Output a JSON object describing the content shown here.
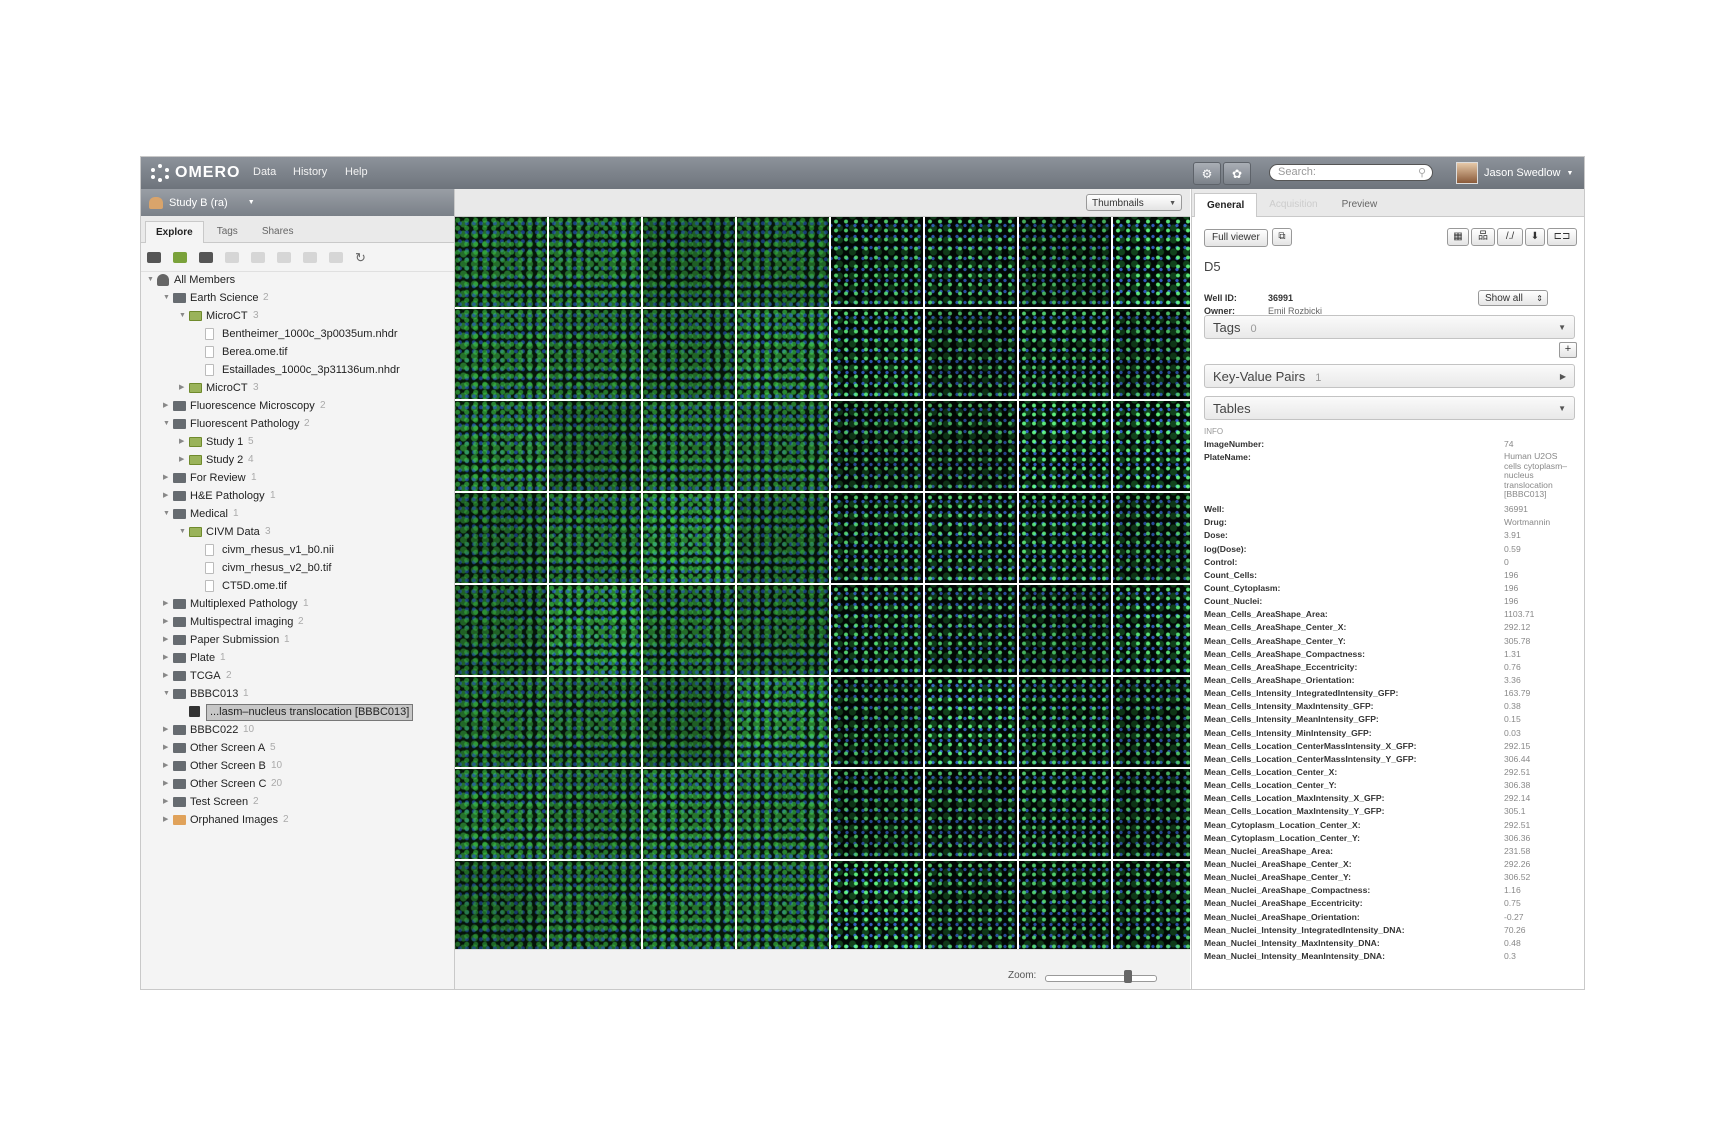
{
  "topbar": {
    "logo": "OMERO",
    "menu": [
      "Data",
      "History",
      "Help"
    ],
    "search_placeholder": "Search:",
    "user": "Jason Swedlow"
  },
  "left": {
    "group": "Study B (ra)",
    "tabs": [
      "Explore",
      "Tags",
      "Shares"
    ],
    "tree": [
      {
        "label": "All Members",
        "count": "",
        "depth": 0,
        "icon": "users-icon",
        "arrow": "down"
      },
      {
        "label": "Earth Science",
        "count": "2",
        "depth": 1,
        "icon": "folder-icon",
        "arrow": "down"
      },
      {
        "label": "MicroCT",
        "count": "3",
        "depth": 2,
        "icon": "project-folder-icon",
        "arrow": "down"
      },
      {
        "label": "Bentheimer_1000c_3p0035um.nhdr",
        "count": "",
        "depth": 3,
        "icon": "file-icon",
        "arrow": ""
      },
      {
        "label": "Berea.ome.tif",
        "count": "",
        "depth": 3,
        "icon": "file-icon",
        "arrow": ""
      },
      {
        "label": "Estaillades_1000c_3p31136um.nhdr",
        "count": "",
        "depth": 3,
        "icon": "file-icon",
        "arrow": ""
      },
      {
        "label": "MicroCT",
        "count": "3",
        "depth": 2,
        "icon": "project-folder-icon",
        "arrow": "right"
      },
      {
        "label": "Fluorescence Microscopy",
        "count": "2",
        "depth": 1,
        "icon": "folder-icon",
        "arrow": "right"
      },
      {
        "label": "Fluorescent Pathology",
        "count": "2",
        "depth": 1,
        "icon": "folder-icon",
        "arrow": "down"
      },
      {
        "label": "Study 1",
        "count": "5",
        "depth": 2,
        "icon": "project-folder-icon",
        "arrow": "right"
      },
      {
        "label": "Study 2",
        "count": "4",
        "depth": 2,
        "icon": "project-folder-icon",
        "arrow": "right"
      },
      {
        "label": "For Review",
        "count": "1",
        "depth": 1,
        "icon": "folder-icon",
        "arrow": "right"
      },
      {
        "label": "H&E Pathology",
        "count": "1",
        "depth": 1,
        "icon": "folder-icon",
        "arrow": "right"
      },
      {
        "label": "Medical",
        "count": "1",
        "depth": 1,
        "icon": "folder-icon",
        "arrow": "down"
      },
      {
        "label": "CIVM Data",
        "count": "3",
        "depth": 2,
        "icon": "project-folder-icon",
        "arrow": "down"
      },
      {
        "label": "civm_rhesus_v1_b0.nii",
        "count": "",
        "depth": 3,
        "icon": "file-icon",
        "arrow": ""
      },
      {
        "label": "civm_rhesus_v2_b0.tif",
        "count": "",
        "depth": 3,
        "icon": "file-icon",
        "arrow": ""
      },
      {
        "label": "CT5D.ome.tif",
        "count": "",
        "depth": 3,
        "icon": "file-icon",
        "arrow": ""
      },
      {
        "label": "Multiplexed Pathology",
        "count": "1",
        "depth": 1,
        "icon": "folder-icon",
        "arrow": "right"
      },
      {
        "label": "Multispectral imaging",
        "count": "2",
        "depth": 1,
        "icon": "folder-icon",
        "arrow": "right"
      },
      {
        "label": "Paper Submission",
        "count": "1",
        "depth": 1,
        "icon": "folder-icon",
        "arrow": "right"
      },
      {
        "label": "Plate",
        "count": "1",
        "depth": 1,
        "icon": "folder-icon",
        "arrow": "right"
      },
      {
        "label": "TCGA",
        "count": "2",
        "depth": 1,
        "icon": "folder-icon",
        "arrow": "right"
      },
      {
        "label": "BBBC013",
        "count": "1",
        "depth": 1,
        "icon": "folder-icon",
        "arrow": "down"
      },
      {
        "label": "...lasm–nucleus translocation [BBBC013]",
        "count": "",
        "depth": 2,
        "icon": "plate-icon",
        "arrow": "",
        "selected": true
      },
      {
        "label": "BBBC022",
        "count": "10",
        "depth": 1,
        "icon": "folder-icon",
        "arrow": "right"
      },
      {
        "label": "Other Screen A",
        "count": "5",
        "depth": 1,
        "icon": "folder-icon",
        "arrow": "right"
      },
      {
        "label": "Other Screen B",
        "count": "10",
        "depth": 1,
        "icon": "folder-icon",
        "arrow": "right"
      },
      {
        "label": "Other Screen C",
        "count": "20",
        "depth": 1,
        "icon": "folder-icon",
        "arrow": "right"
      },
      {
        "label": "Test Screen",
        "count": "2",
        "depth": 1,
        "icon": "folder-icon",
        "arrow": "right"
      },
      {
        "label": "Orphaned Images",
        "count": "2",
        "depth": 1,
        "icon": "orphaned-folder-icon",
        "arrow": "right"
      }
    ]
  },
  "center": {
    "view_select": "Thumbnails",
    "zoom_label": "Zoom:",
    "zoom_level": 0.75,
    "grid": {
      "rows": 8,
      "cols": 8
    }
  },
  "right": {
    "tabs": [
      "General",
      "Acquisition",
      "Preview"
    ],
    "full_viewer": "Full viewer",
    "well_name": "D5",
    "well_id_label": "Well ID:",
    "well_id": "36991",
    "owner_label": "Owner:",
    "owner": "Emil Rozbicki",
    "show_all": "Show all",
    "tags_label": "Tags",
    "tags_count": "0",
    "kvp_label": "Key-Value Pairs",
    "kvp_count": "1",
    "tables_label": "Tables",
    "info_label": "INFO",
    "info": [
      {
        "k": "ImageNumber:",
        "v": "74"
      },
      {
        "k": "PlateName:",
        "v": "Human U2OS cells cytoplasm–nucleus translocation [BBBC013]",
        "multiline": true
      },
      {
        "k": "Well:",
        "v": "36991"
      },
      {
        "k": "Drug:",
        "v": "Wortmannin"
      },
      {
        "k": "Dose:",
        "v": "3.91"
      },
      {
        "k": "log(Dose):",
        "v": "0.59"
      },
      {
        "k": "Control:",
        "v": "0"
      },
      {
        "k": "Count_Cells:",
        "v": "196"
      },
      {
        "k": "Count_Cytoplasm:",
        "v": "196"
      },
      {
        "k": "Count_Nuclei:",
        "v": "196"
      },
      {
        "k": "Mean_Cells_AreaShape_Area:",
        "v": "1103.71"
      },
      {
        "k": "Mean_Cells_AreaShape_Center_X:",
        "v": "292.12"
      },
      {
        "k": "Mean_Cells_AreaShape_Center_Y:",
        "v": "305.78"
      },
      {
        "k": "Mean_Cells_AreaShape_Compactness:",
        "v": "1.31"
      },
      {
        "k": "Mean_Cells_AreaShape_Eccentricity:",
        "v": "0.76"
      },
      {
        "k": "Mean_Cells_AreaShape_Orientation:",
        "v": "3.36"
      },
      {
        "k": "Mean_Cells_Intensity_IntegratedIntensity_GFP:",
        "v": "163.79"
      },
      {
        "k": "Mean_Cells_Intensity_MaxIntensity_GFP:",
        "v": "0.38"
      },
      {
        "k": "Mean_Cells_Intensity_MeanIntensity_GFP:",
        "v": "0.15"
      },
      {
        "k": "Mean_Cells_Intensity_MinIntensity_GFP:",
        "v": "0.03"
      },
      {
        "k": "Mean_Cells_Location_CenterMassIntensity_X_GFP:",
        "v": "292.15"
      },
      {
        "k": "Mean_Cells_Location_CenterMassIntensity_Y_GFP:",
        "v": "306.44"
      },
      {
        "k": "Mean_Cells_Location_Center_X:",
        "v": "292.51"
      },
      {
        "k": "Mean_Cells_Location_Center_Y:",
        "v": "306.38"
      },
      {
        "k": "Mean_Cells_Location_MaxIntensity_X_GFP:",
        "v": "292.14"
      },
      {
        "k": "Mean_Cells_Location_MaxIntensity_Y_GFP:",
        "v": "305.1"
      },
      {
        "k": "Mean_Cytoplasm_Location_Center_X:",
        "v": "292.51"
      },
      {
        "k": "Mean_Cytoplasm_Location_Center_Y:",
        "v": "306.36"
      },
      {
        "k": "Mean_Nuclei_AreaShape_Area:",
        "v": "231.58"
      },
      {
        "k": "Mean_Nuclei_AreaShape_Center_X:",
        "v": "292.26"
      },
      {
        "k": "Mean_Nuclei_AreaShape_Center_Y:",
        "v": "306.52"
      },
      {
        "k": "Mean_Nuclei_AreaShape_Compactness:",
        "v": "1.16"
      },
      {
        "k": "Mean_Nuclei_AreaShape_Eccentricity:",
        "v": "0.75"
      },
      {
        "k": "Mean_Nuclei_AreaShape_Orientation:",
        "v": "-0.27"
      },
      {
        "k": "Mean_Nuclei_Intensity_IntegratedIntensity_DNA:",
        "v": "70.26"
      },
      {
        "k": "Mean_Nuclei_Intensity_MaxIntensity_DNA:",
        "v": "0.48"
      },
      {
        "k": "Mean_Nuclei_Intensity_MeanIntensity_DNA:",
        "v": "0.3"
      }
    ]
  },
  "colors": {
    "accent_topbar": "#7a8088",
    "gfp_green": "#2fb33a",
    "dna_blue": "#2a4fb0"
  }
}
